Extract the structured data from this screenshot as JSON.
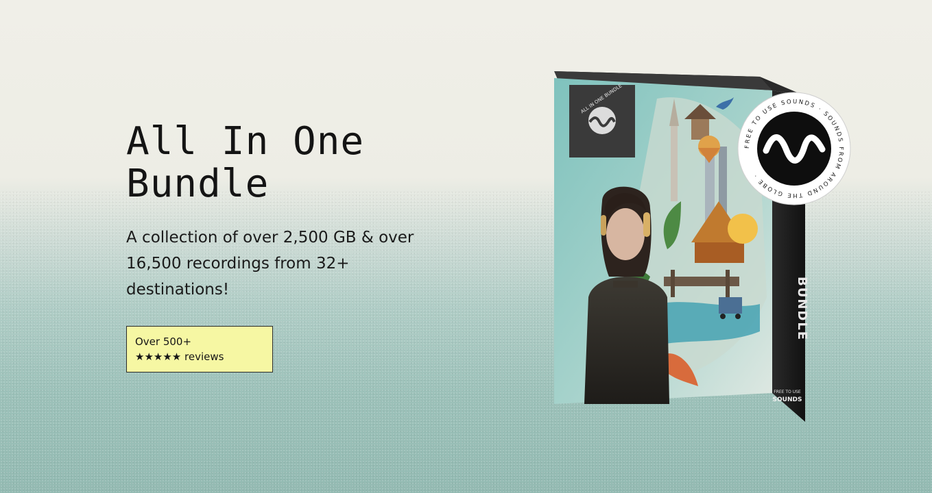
{
  "hero": {
    "title_line1": "All In One",
    "title_line2": "Bundle",
    "description": "A collection of over 2,500 GB & over 16,500 recordings from 32+ destinations!"
  },
  "reviews": {
    "line1": "Over 500+",
    "stars": "★★★★★",
    "label": "reviews"
  },
  "product_box": {
    "corner_label": "ALL IN ONE BUNDLE",
    "spine_text": "BUNDLE",
    "brand_line1": "FREE TO USE",
    "brand_line2": "SOUNDS"
  },
  "seal": {
    "text": "FREE TO USE SOUNDS · SOUNDS FROM AROUND THE GLOBE ·"
  },
  "icons": {
    "logo": "sound-wave-icon",
    "stars": "star-icon"
  },
  "colors": {
    "badge_bg": "#f6f7a3",
    "box_teal": "#8cc5c0",
    "box_dark": "#1c1c1c",
    "text": "#141414"
  }
}
